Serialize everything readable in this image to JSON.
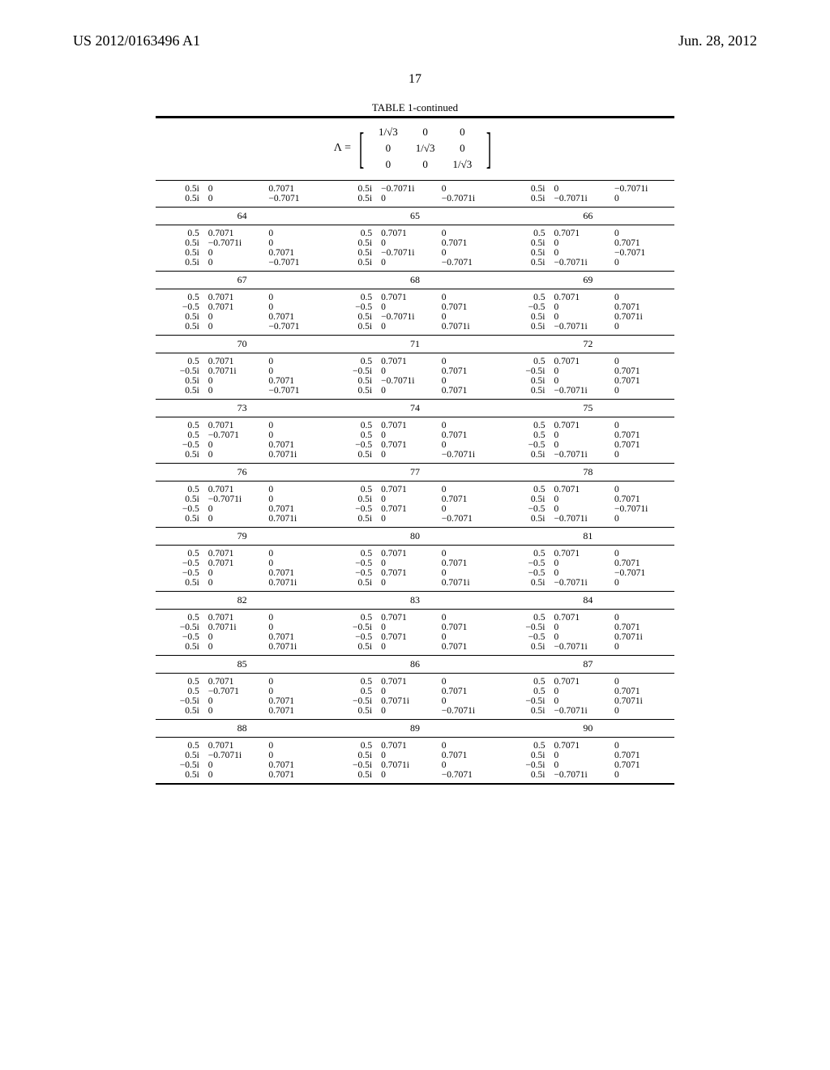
{
  "header": {
    "pub_number": "US 2012/0163496 A1",
    "pub_date": "Jun. 28, 2012"
  },
  "page_number": "17",
  "table": {
    "caption": "TABLE 1-continued",
    "matrix_label": "Λ =",
    "matrix_root": "√3",
    "matrix_cells": [
      [
        "1/√3",
        "0",
        "0"
      ],
      [
        "0",
        "1/√3",
        "0"
      ],
      [
        "0",
        "0",
        "1/√3"
      ]
    ],
    "pre_block": {
      "cols": [
        [
          [
            "0.5i",
            "0",
            "0.7071"
          ],
          [
            "0.5i",
            "0",
            "−0.7071"
          ]
        ],
        [
          [
            "0.5i",
            "−0.7071i",
            "0"
          ],
          [
            "0.5i",
            "0",
            "−0.7071i"
          ]
        ],
        [
          [
            "0.5i",
            "0",
            "−0.7071i"
          ],
          [
            "0.5i",
            "−0.7071i",
            "0"
          ]
        ]
      ]
    },
    "groups": [
      {
        "indices": [
          "64",
          "65",
          "66"
        ],
        "cols": [
          [
            [
              "0.5",
              "0.7071",
              "0"
            ],
            [
              "0.5i",
              "−0.7071i",
              "0"
            ],
            [
              "0.5i",
              "0",
              "0.7071"
            ],
            [
              "0.5i",
              "0",
              "−0.7071"
            ]
          ],
          [
            [
              "0.5",
              "0.7071",
              "0"
            ],
            [
              "0.5i",
              "0",
              "0.7071"
            ],
            [
              "0.5i",
              "−0.7071i",
              "0"
            ],
            [
              "0.5i",
              "0",
              "−0.7071"
            ]
          ],
          [
            [
              "0.5",
              "0.7071",
              "0"
            ],
            [
              "0.5i",
              "0",
              "0.7071"
            ],
            [
              "0.5i",
              "0",
              "−0.7071"
            ],
            [
              "0.5i",
              "−0.7071i",
              "0"
            ]
          ]
        ]
      },
      {
        "indices": [
          "67",
          "68",
          "69"
        ],
        "cols": [
          [
            [
              "0.5",
              "0.7071",
              "0"
            ],
            [
              "−0.5",
              "0.7071",
              "0"
            ],
            [
              "0.5i",
              "0",
              "0.7071"
            ],
            [
              "0.5i",
              "0",
              "−0.7071"
            ]
          ],
          [
            [
              "0.5",
              "0.7071",
              "0"
            ],
            [
              "−0.5",
              "0",
              "0.7071"
            ],
            [
              "0.5i",
              "−0.7071i",
              "0"
            ],
            [
              "0.5i",
              "0",
              "0.7071i"
            ]
          ],
          [
            [
              "0.5",
              "0.7071",
              "0"
            ],
            [
              "−0.5",
              "0",
              "0.7071"
            ],
            [
              "0.5i",
              "0",
              "0.7071i"
            ],
            [
              "0.5i",
              "−0.7071i",
              "0"
            ]
          ]
        ]
      },
      {
        "indices": [
          "70",
          "71",
          "72"
        ],
        "cols": [
          [
            [
              "0.5",
              "0.7071",
              "0"
            ],
            [
              "−0.5i",
              "0.7071i",
              "0"
            ],
            [
              "0.5i",
              "0",
              "0.7071"
            ],
            [
              "0.5i",
              "0",
              "−0.7071"
            ]
          ],
          [
            [
              "0.5",
              "0.7071",
              "0"
            ],
            [
              "−0.5i",
              "0",
              "0.7071"
            ],
            [
              "0.5i",
              "−0.7071i",
              "0"
            ],
            [
              "0.5i",
              "0",
              "0.7071"
            ]
          ],
          [
            [
              "0.5",
              "0.7071",
              "0"
            ],
            [
              "−0.5i",
              "0",
              "0.7071"
            ],
            [
              "0.5i",
              "0",
              "0.7071"
            ],
            [
              "0.5i",
              "−0.7071i",
              "0"
            ]
          ]
        ]
      },
      {
        "indices": [
          "73",
          "74",
          "75"
        ],
        "cols": [
          [
            [
              "0.5",
              "0.7071",
              "0"
            ],
            [
              "0.5",
              "−0.7071",
              "0"
            ],
            [
              "−0.5",
              "0",
              "0.7071"
            ],
            [
              "0.5i",
              "0",
              "0.7071i"
            ]
          ],
          [
            [
              "0.5",
              "0.7071",
              "0"
            ],
            [
              "0.5",
              "0",
              "0.7071"
            ],
            [
              "−0.5",
              "0.7071",
              "0"
            ],
            [
              "0.5i",
              "0",
              "−0.7071i"
            ]
          ],
          [
            [
              "0.5",
              "0.7071",
              "0"
            ],
            [
              "0.5",
              "0",
              "0.7071"
            ],
            [
              "−0.5",
              "0",
              "0.7071"
            ],
            [
              "0.5i",
              "−0.7071i",
              "0"
            ]
          ]
        ]
      },
      {
        "indices": [
          "76",
          "77",
          "78"
        ],
        "cols": [
          [
            [
              "0.5",
              "0.7071",
              "0"
            ],
            [
              "0.5i",
              "−0.7071i",
              "0"
            ],
            [
              "−0.5",
              "0",
              "0.7071"
            ],
            [
              "0.5i",
              "0",
              "0.7071i"
            ]
          ],
          [
            [
              "0.5",
              "0.7071",
              "0"
            ],
            [
              "0.5i",
              "0",
              "0.7071"
            ],
            [
              "−0.5",
              "0.7071",
              "0"
            ],
            [
              "0.5i",
              "0",
              "−0.7071"
            ]
          ],
          [
            [
              "0.5",
              "0.7071",
              "0"
            ],
            [
              "0.5i",
              "0",
              "0.7071"
            ],
            [
              "−0.5",
              "0",
              "−0.7071i"
            ],
            [
              "0.5i",
              "−0.7071i",
              "0"
            ]
          ]
        ]
      },
      {
        "indices": [
          "79",
          "80",
          "81"
        ],
        "cols": [
          [
            [
              "0.5",
              "0.7071",
              "0"
            ],
            [
              "−0.5",
              "0.7071",
              "0"
            ],
            [
              "−0.5",
              "0",
              "0.7071"
            ],
            [
              "0.5i",
              "0",
              "0.7071i"
            ]
          ],
          [
            [
              "0.5",
              "0.7071",
              "0"
            ],
            [
              "−0.5",
              "0",
              "0.7071"
            ],
            [
              "−0.5",
              "0.7071",
              "0"
            ],
            [
              "0.5i",
              "0",
              "0.7071i"
            ]
          ],
          [
            [
              "0.5",
              "0.7071",
              "0"
            ],
            [
              "−0.5",
              "0",
              "0.7071"
            ],
            [
              "−0.5",
              "0",
              "−0.7071"
            ],
            [
              "0.5i",
              "−0.7071i",
              "0"
            ]
          ]
        ]
      },
      {
        "indices": [
          "82",
          "83",
          "84"
        ],
        "cols": [
          [
            [
              "0.5",
              "0.7071",
              "0"
            ],
            [
              "−0.5i",
              "0.7071i",
              "0"
            ],
            [
              "−0.5",
              "0",
              "0.7071"
            ],
            [
              "0.5i",
              "0",
              "0.7071i"
            ]
          ],
          [
            [
              "0.5",
              "0.7071",
              "0"
            ],
            [
              "−0.5i",
              "0",
              "0.7071"
            ],
            [
              "−0.5",
              "0.7071",
              "0"
            ],
            [
              "0.5i",
              "0",
              "0.7071"
            ]
          ],
          [
            [
              "0.5",
              "0.7071",
              "0"
            ],
            [
              "−0.5i",
              "0",
              "0.7071"
            ],
            [
              "−0.5",
              "0",
              "0.7071i"
            ],
            [
              "0.5i",
              "−0.7071i",
              "0"
            ]
          ]
        ]
      },
      {
        "indices": [
          "85",
          "86",
          "87"
        ],
        "cols": [
          [
            [
              "0.5",
              "0.7071",
              "0"
            ],
            [
              "0.5",
              "−0.7071",
              "0"
            ],
            [
              "−0.5i",
              "0",
              "0.7071"
            ],
            [
              "0.5i",
              "0",
              "0.7071"
            ]
          ],
          [
            [
              "0.5",
              "0.7071",
              "0"
            ],
            [
              "0.5",
              "0",
              "0.7071"
            ],
            [
              "−0.5i",
              "0.7071i",
              "0"
            ],
            [
              "0.5i",
              "0",
              "−0.7071i"
            ]
          ],
          [
            [
              "0.5",
              "0.7071",
              "0"
            ],
            [
              "0.5",
              "0",
              "0.7071"
            ],
            [
              "−0.5i",
              "0",
              "0.7071i"
            ],
            [
              "0.5i",
              "−0.7071i",
              "0"
            ]
          ]
        ]
      },
      {
        "indices": [
          "88",
          "89",
          "90"
        ],
        "cols": [
          [
            [
              "0.5",
              "0.7071",
              "0"
            ],
            [
              "0.5i",
              "−0.7071i",
              "0"
            ],
            [
              "−0.5i",
              "0",
              "0.7071"
            ],
            [
              "0.5i",
              "0",
              "0.7071"
            ]
          ],
          [
            [
              "0.5",
              "0.7071",
              "0"
            ],
            [
              "0.5i",
              "0",
              "0.7071"
            ],
            [
              "−0.5i",
              "0.7071i",
              "0"
            ],
            [
              "0.5i",
              "0",
              "−0.7071"
            ]
          ],
          [
            [
              "0.5",
              "0.7071",
              "0"
            ],
            [
              "0.5i",
              "0",
              "0.7071"
            ],
            [
              "−0.5i",
              "0",
              "0.7071"
            ],
            [
              "0.5i",
              "−0.7071i",
              "0"
            ]
          ]
        ]
      }
    ]
  }
}
